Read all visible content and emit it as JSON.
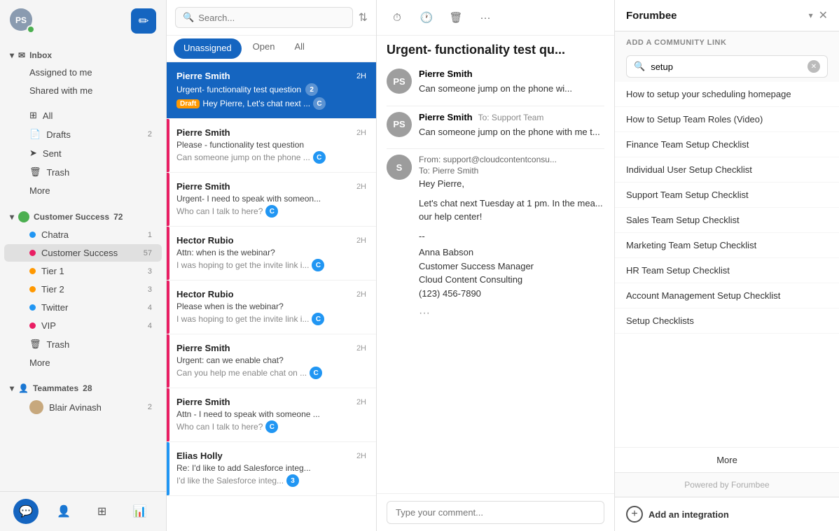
{
  "sidebar": {
    "user_initials": "PS",
    "compose_label": "✏",
    "inbox_label": "Inbox",
    "assigned_to_me": "Assigned to me",
    "shared_with_me": "Shared with me",
    "all_label": "All",
    "drafts_label": "Drafts",
    "drafts_count": "2",
    "sent_label": "Sent",
    "trash_label": "Trash",
    "more_label": "More",
    "customer_success_label": "Customer Success",
    "customer_success_count": "72",
    "chatra_label": "Chatra",
    "chatra_count": "1",
    "cs_sub_label": "Customer Success",
    "cs_sub_count": "57",
    "tier1_label": "Tier 1",
    "tier1_count": "3",
    "tier2_label": "Tier 2",
    "tier2_count": "3",
    "twitter_label": "Twitter",
    "twitter_count": "4",
    "vip_label": "VIP",
    "vip_count": "4",
    "trash_sub_label": "Trash",
    "more2_label": "More",
    "teammates_label": "Teammates",
    "teammates_count": "28",
    "blair_label": "Blair Avinash",
    "blair_count": "2"
  },
  "conv_list": {
    "search_placeholder": "Search...",
    "tab_unassigned": "Unassigned",
    "tab_open": "Open",
    "tab_all": "All",
    "items": [
      {
        "sender": "Pierre Smith",
        "time": "2H",
        "subject": "Urgent- functionality test question",
        "badge_count": "2",
        "preview": "Hey Pierre, Let's chat next ...",
        "has_draft": true,
        "selected": true,
        "indicator": "pink"
      },
      {
        "sender": "Pierre Smith",
        "time": "2H",
        "subject": "Please - functionality test question",
        "badge_count": "",
        "preview": "Can someone jump on the phone ...",
        "has_draft": false,
        "selected": false,
        "indicator": "pink"
      },
      {
        "sender": "Pierre Smith",
        "time": "2H",
        "subject": "Urgent- I need to speak with someon...",
        "badge_count": "",
        "preview": "Who can I talk to here?",
        "has_draft": false,
        "selected": false,
        "indicator": "pink"
      },
      {
        "sender": "Hector Rubio",
        "time": "2H",
        "subject": "Attn: when is the webinar?",
        "badge_count": "",
        "preview": "I was hoping to get the invite link i...",
        "has_draft": false,
        "selected": false,
        "indicator": "pink"
      },
      {
        "sender": "Hector Rubio",
        "time": "2H",
        "subject": "Please when is the webinar?",
        "badge_count": "",
        "preview": "I was hoping to get the invite link i...",
        "has_draft": false,
        "selected": false,
        "indicator": "pink"
      },
      {
        "sender": "Pierre Smith",
        "time": "2H",
        "subject": "Urgent: can we enable chat?",
        "badge_count": "",
        "preview": "Can you help me enable chat on ...",
        "has_draft": false,
        "selected": false,
        "indicator": "pink"
      },
      {
        "sender": "Pierre Smith",
        "time": "2H",
        "subject": "Attn - I need to speak with someone ...",
        "badge_count": "",
        "preview": "Who can I talk to here?",
        "has_draft": false,
        "selected": false,
        "indicator": "pink"
      },
      {
        "sender": "Elias Holly",
        "time": "2H",
        "subject": "Re: I'd like to add Salesforce integ...",
        "badge_count": "3",
        "preview": "I'd like the Salesforce integ...",
        "has_draft": false,
        "selected": false,
        "indicator": "blue"
      }
    ]
  },
  "main": {
    "title": "Urgent- functionality test qu...",
    "messages": [
      {
        "avatar_initials": "PS",
        "sender": "Pierre Smith",
        "direction": "incoming",
        "preview": "Can someone jump on the phone wi..."
      },
      {
        "avatar_initials": "PS",
        "sender": "Pierre Smith",
        "to": "To: Support Team",
        "body": "Can someone jump on the phone with me t..."
      },
      {
        "avatar_initials": "S",
        "from_email": "support@cloudcontentconsu...",
        "to_email": "Pierre Smith",
        "body_greeting": "Hey Pierre,",
        "body_text": "Let's chat next Tuesday at 1 pm. In the mea... our help center!",
        "signature_dashes": "--",
        "signature_name": "Anna Babson",
        "signature_title": "Customer Success Manager",
        "signature_company": "Cloud Content Consulting",
        "signature_phone": "(123) 456-7890"
      }
    ],
    "compose_placeholder": "Type your comment..."
  },
  "panel": {
    "title": "Forumbee",
    "section_label": "ADD A COMMUNITY LINK",
    "search_value": "setup",
    "links": [
      "How to setup your scheduling homepage",
      "How to Setup Team Roles (Video)",
      "Finance Team Setup Checklist",
      "Individual User Setup Checklist",
      "Support Team Setup Checklist",
      "Sales Team Setup Checklist",
      "Marketing Team Setup Checklist",
      "HR Team Setup Checklist",
      "Account Management Setup Checklist",
      "Setup Checklists"
    ],
    "more_label": "More",
    "footer_text": "Powered by Forumbee",
    "add_integration_label": "Add an integration"
  }
}
